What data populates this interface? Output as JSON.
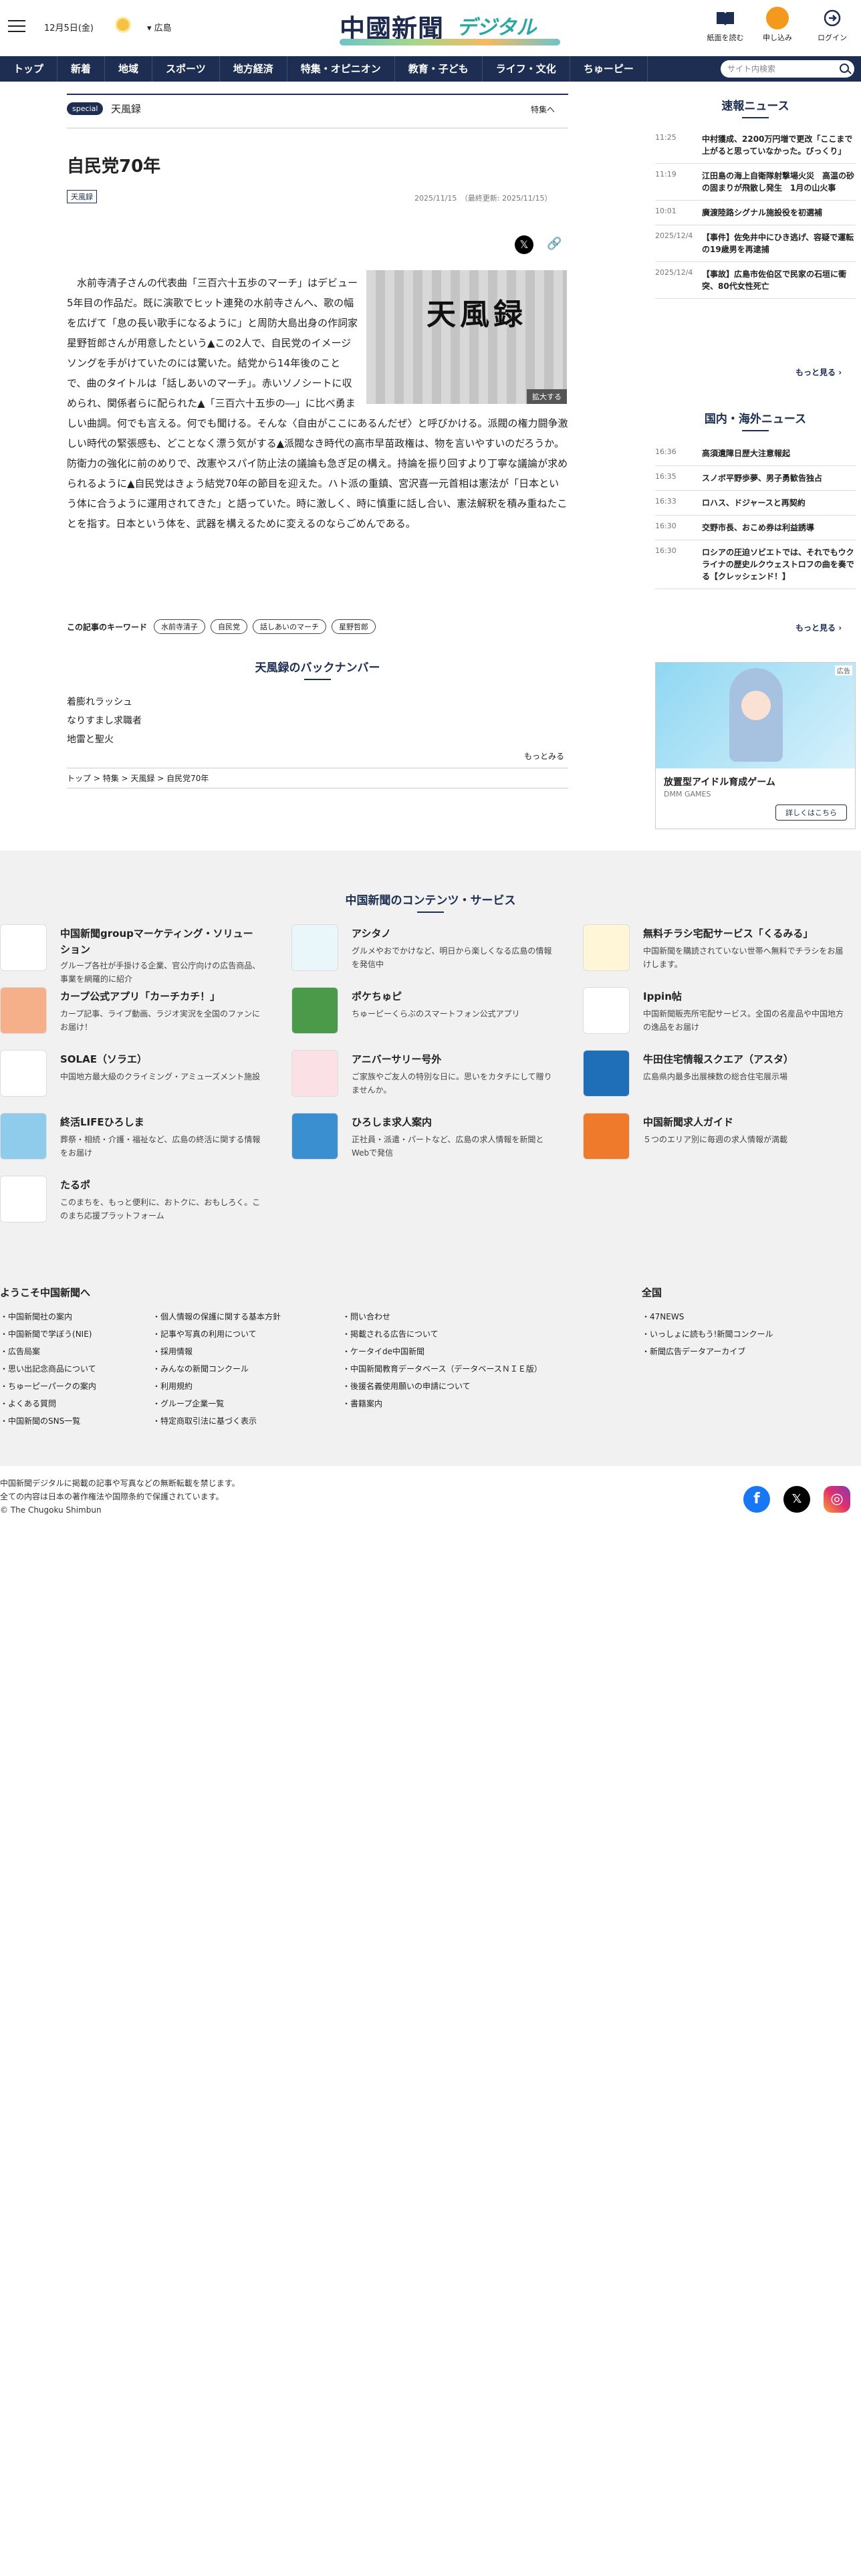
{
  "header": {
    "date": "12月5日(金)",
    "location": "広島",
    "logo_main": "中國新聞",
    "logo_sub": "デジタル",
    "btn_paper": "紙面を読む",
    "btn_apply": "申し込み",
    "btn_login": "ログイン"
  },
  "nav": {
    "items": [
      "トップ",
      "新着",
      "地域",
      "スポーツ",
      "地方経済",
      "特集・オピニオン",
      "教育・子ども",
      "ライフ・文化",
      "ちゅーピー"
    ],
    "search_placeholder": "サイト内検索"
  },
  "article": {
    "special_badge": "special",
    "series": "天風録",
    "to_special": "特集へ",
    "title": "自民党70年",
    "tag": "天風録",
    "dates": "2025/11/15　（最終更新: 2025/11/15）",
    "image_caption": "天風録",
    "image_enlarge": "拡大する",
    "body": "　水前寺清子さんの代表曲「三百六十五歩のマーチ」はデビュー5年目の作品だ。既に演歌でヒット連発の水前寺さんへ、歌の幅を広げて「息の長い歌手になるように」と周防大島出身の作詞家星野哲郎さんが用意したという▲この2人で、自民党のイメージソングを手がけていたのには驚いた。結党から14年後のことで、曲のタイトルは「話しあいのマーチ」。赤いソノシートに収められ、関係者らに配られた▲「三百六十五歩の―」に比べ勇ましい曲調。何でも言える。何でも聞ける。そんな〈自由がここにあるんだぜ〉と呼びかける。派閥の権力闘争激しい時代の緊張感も、どことなく漂う気がする▲派閥なき時代の高市早苗政権は、物を言いやすいのだろうか。防衛力の強化に前のめりで、改憲やスパイ防止法の議論も急ぎ足の構え。持論を振り回すより丁寧な議論が求められるように▲自民党はきょう結党70年の節目を迎えた。ハト派の重鎮、宮沢喜一元首相は憲法が「日本という体に合うように運用されてきた」と語っていた。時に激しく、時に慎重に話し合い、憲法解釈を積み重ねたことを指す。日本という体を、武器を構えるために変えるのならごめんである。",
    "keywords_label": "この記事のキーワード",
    "keywords": [
      "水前寺清子",
      "自民党",
      "話しあいのマーチ",
      "星野哲郎"
    ],
    "backnumber_title": "天風録のバックナンバー",
    "backnumbers": [
      "着膨れラッシュ",
      "なりすまし求職者",
      "地雷と聖火"
    ],
    "more": "もっとみる",
    "breadcrumb": [
      "トップ",
      "特集",
      "天風録",
      "自民党70年"
    ]
  },
  "sidebar": {
    "breaking_title": "速報ニュース",
    "breaking": [
      {
        "time": "11:25",
        "head": "中村獲成、2200万円増で更改「ここまで上がると思っていなかった。びっくり」"
      },
      {
        "time": "11:19",
        "head": "江田島の海上自衛隊射撃場火災　高温の砂の固まりが飛散し発生　1月の山火事"
      },
      {
        "time": "10:01",
        "head": "廣渡陸路シグナル施設役を初選補"
      },
      {
        "time": "2025/12/4",
        "head": "【事件】佐免井中にひき逃げ、容疑で運転の19歳男を再逮捕"
      },
      {
        "time": "2025/12/4",
        "head": "【事故】広島市佐伯区で民家の石垣に衝突、80代女性死亡"
      }
    ],
    "more": "もっと見る",
    "world_title": "国内・海外ニュース",
    "world": [
      {
        "time": "16:36",
        "head": "高須遺障日歴大注意報起"
      },
      {
        "time": "16:35",
        "head": "スノボ平野歩夢、男子勇歓告独占"
      },
      {
        "time": "16:33",
        "head": "ロハス、ドジャースと再契約"
      },
      {
        "time": "16:30",
        "head": "交野市長、おこめ券は利益誘導"
      },
      {
        "time": "16:30",
        "head": "ロシアの圧迫ソビエトでは、それでもウクライナの歴史ルクウェストロフの曲を奏でる【クレッシェンド！】"
      }
    ],
    "ad": {
      "label": "広告",
      "title": "放置型アイドル育成ゲーム",
      "sub": "DMM GAMES",
      "btn": "詳しくはこちら"
    }
  },
  "footer": {
    "services_title": "中国新聞のコンテンツ・サービス",
    "services": [
      {
        "name": "中国新聞groupマーケティング・ソリューション",
        "desc": "グループ各社が手掛ける企業、官公庁向けの広告商品、事業を網羅的に紹介",
        "color": "#ffffff"
      },
      {
        "name": "アシタノ",
        "desc": "グルメやおでかけなど、明日から楽しくなる広島の情報を発信中",
        "color": "#e9f6fa"
      },
      {
        "name": "無料チラシ宅配サービス「くるみる」",
        "desc": "中国新聞を購読されていない世帯へ無料でチラシをお届けします。",
        "color": "#fff6d8"
      },
      {
        "name": "カープ公式アプリ「カーチカチ！」",
        "desc": "カープ記事、ライブ動画、ラジオ実況を全国のファンにお届け！",
        "color": "#f6b089"
      },
      {
        "name": "ポケちゅピ",
        "desc": "ちゅーピーくらぶのスマートフォン公式アプリ",
        "color": "#4a9a4a"
      },
      {
        "name": "Ippin帖",
        "desc": "中国新聞販売所宅配サービス。全国の名産品や中国地方の逸品をお届け",
        "color": "#ffffff"
      },
      {
        "name": "SOLAE（ソラエ）",
        "desc": "中国地方最大級のクライミング・アミューズメント施設",
        "color": "#ffffff"
      },
      {
        "name": "アニバーサリー号外",
        "desc": "ご家族やご友人の特別な日に。思いをカタチにして贈りませんか。",
        "color": "#fbe0e6"
      },
      {
        "name": "牛田住宅情報スクエア（アスタ）",
        "desc": "広島県内最多出展棟数の総合住宅展示場",
        "color": "#1f6fb8"
      },
      {
        "name": "終活LIFEひろしま",
        "desc": "葬祭・相続・介護・福祉など、広島の終活に関する情報をお届け",
        "color": "#8fcbea"
      },
      {
        "name": "ひろしま求人案内",
        "desc": "正社員・派遣・パートなど、広島の求人情報を新聞とWebで発信",
        "color": "#3a8fd1"
      },
      {
        "name": "中国新聞求人ガイド",
        "desc": "５つのエリア別に毎週の求人情報が満載",
        "color": "#f07a2b"
      },
      {
        "name": "たるポ",
        "desc": "このまちを、もっと便利に、おトクに、おもしろく。このまち応援プラットフォーム",
        "color": "#ffffff"
      }
    ],
    "welcome": "ようこそ中国新聞へ",
    "col1": [
      "中国新聞社の案内",
      "中国新聞で学ぼう(NIE)",
      "広告局案",
      "思い出記念商品について",
      "ちゅーピーパークの案内",
      "よくある質問",
      "中国新聞のSNS一覧"
    ],
    "col2": [
      "個人情報の保護に関する基本方針",
      "記事や写真の利用について",
      "採用情報",
      "みんなの新聞コンクール",
      "利用規約",
      "グループ企業一覧",
      "特定商取引法に基づく表示"
    ],
    "col3": [
      "問い合わせ",
      "掲載される広告について",
      "ケータイde中国新聞",
      "中国新聞教育データベース（データベースＮＩＥ版）",
      "後援名義使用願いの申請について",
      "書籍案内"
    ],
    "zenkoku_title": "全国",
    "col4": [
      "47NEWS",
      "いっしょに読もう!新聞コンクール",
      "新聞広告データアーカイブ"
    ],
    "copyright": [
      "中国新聞デジタルに掲載の記事や写真などの無断転載を禁じます。",
      "全ての内容は日本の著作権法や国際条約で保護されています。",
      "© The Chugoku Shimbun"
    ]
  }
}
